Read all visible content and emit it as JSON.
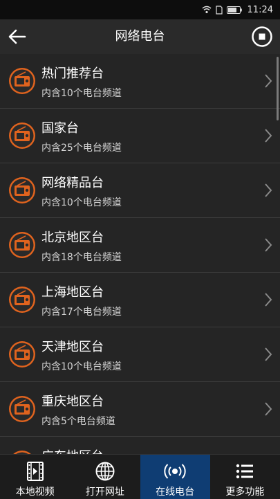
{
  "status_bar": {
    "time": "11:24"
  },
  "header": {
    "title": "网络电台"
  },
  "stations": [
    {
      "name": "热门推荐台",
      "desc": "内含10个电台频道"
    },
    {
      "name": "国家台",
      "desc": "内含25个电台频道"
    },
    {
      "name": "网络精品台",
      "desc": "内含10个电台频道"
    },
    {
      "name": "北京地区台",
      "desc": "内含18个电台频道"
    },
    {
      "name": "上海地区台",
      "desc": "内含17个电台频道"
    },
    {
      "name": "天津地区台",
      "desc": "内含10个电台频道"
    },
    {
      "name": "重庆地区台",
      "desc": "内含5个电台频道"
    },
    {
      "name": "广东地区台",
      "desc": ""
    }
  ],
  "bottom_nav": [
    {
      "label": "本地视频",
      "icon": "film-icon"
    },
    {
      "label": "打开网址",
      "icon": "globe-icon"
    },
    {
      "label": "在线电台",
      "icon": "broadcast-icon",
      "active": true
    },
    {
      "label": "更多功能",
      "icon": "list-icon"
    }
  ],
  "colors": {
    "accent": "#e0631e",
    "active_tab": "#0f3d73",
    "background": "#232323"
  }
}
